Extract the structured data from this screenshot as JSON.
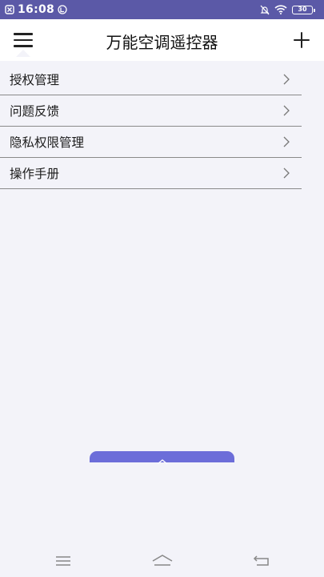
{
  "status_bar": {
    "time": "16:08",
    "battery_level": "30"
  },
  "header": {
    "title": "万能空调遥控器"
  },
  "menu": {
    "items": [
      {
        "label": "授权管理"
      },
      {
        "label": "问题反馈"
      },
      {
        "label": "隐私权限管理"
      },
      {
        "label": "操作手册"
      }
    ]
  },
  "colors": {
    "status_bar": "#5b59a7",
    "accent": "#6c6dd9",
    "background": "#f3f3f9"
  },
  "icons": {
    "menu": "hamburger-icon",
    "add": "plus-icon",
    "chevron": "chevron-right-icon",
    "pull_up": "chevron-up-icon",
    "nav_menu": "nav-menu-icon",
    "nav_home": "nav-home-icon",
    "nav_back": "nav-back-icon"
  }
}
